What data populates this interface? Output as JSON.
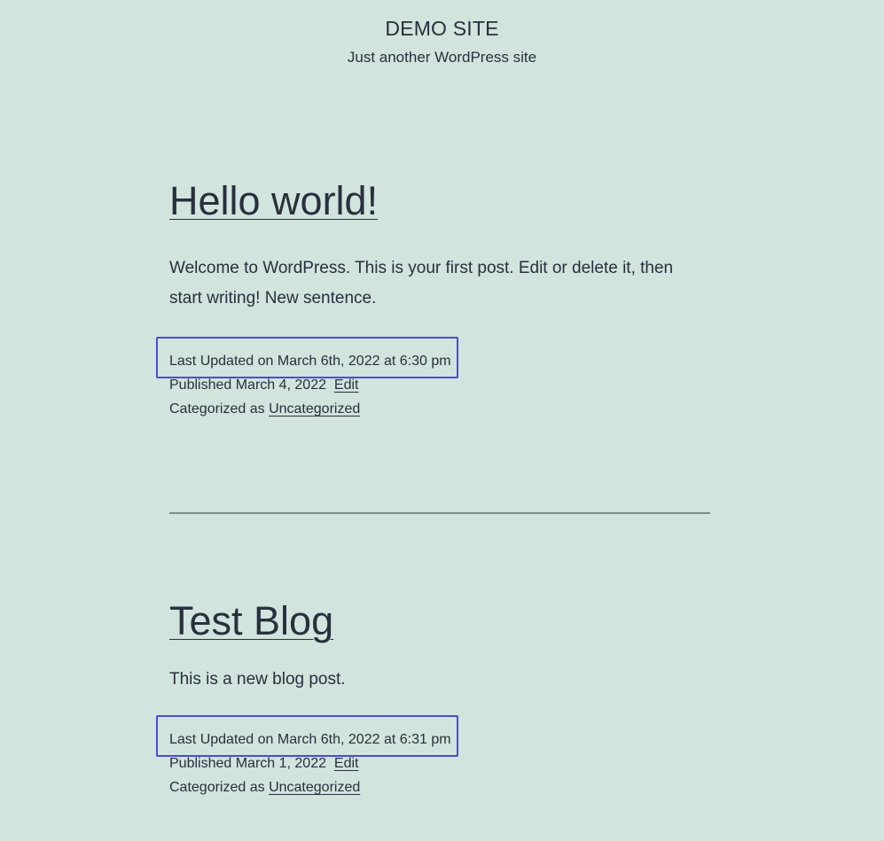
{
  "site": {
    "title": "DEMO SITE",
    "tagline": "Just another WordPress site"
  },
  "posts": [
    {
      "title": "Hello world!",
      "excerpt": "Welcome to WordPress. This is your first post. Edit or delete it, then start writing! New sentence.",
      "last_updated": "Last Updated on March 6th, 2022 at 6:30 pm",
      "published": "Published March 4, 2022",
      "edit_label": "Edit",
      "categorized_label": "Categorized as",
      "category": "Uncategorized"
    },
    {
      "title": "Test Blog",
      "excerpt": "This is a new blog post.",
      "last_updated": "Last Updated on March 6th, 2022 at 6:31 pm",
      "published": "Published March 1, 2022",
      "edit_label": "Edit",
      "categorized_label": "Categorized as",
      "category": "Uncategorized"
    }
  ],
  "colors": {
    "background": "#d1e4dd",
    "text": "#28303d",
    "highlight_box": "#4a4ae0",
    "separator": "#7c8c8a"
  }
}
